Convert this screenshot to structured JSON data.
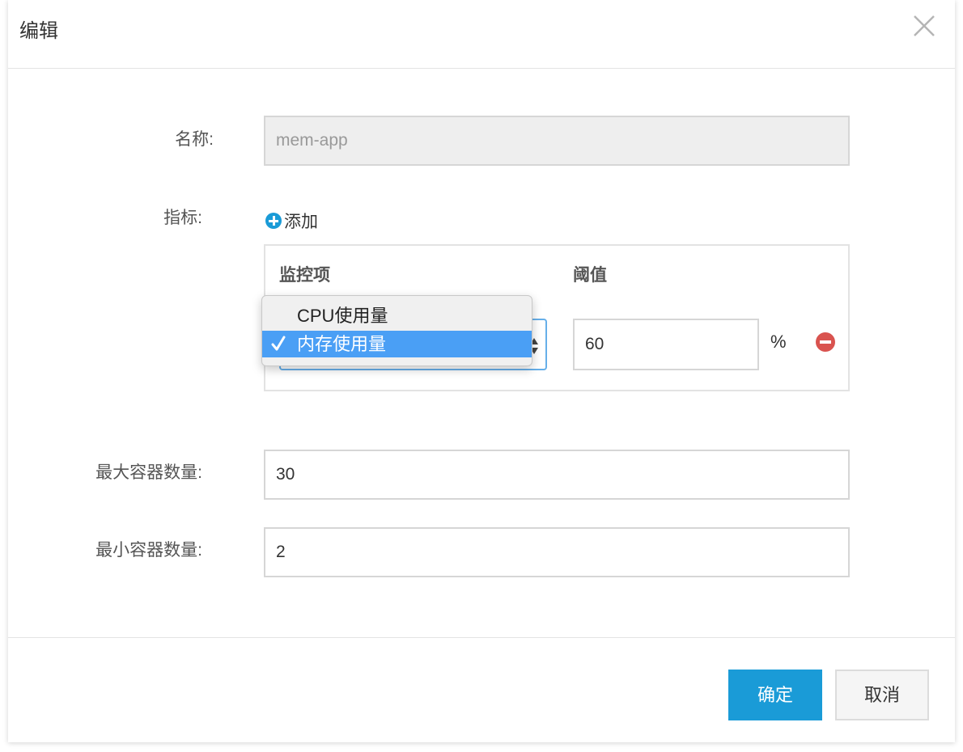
{
  "dialog": {
    "title": "编辑"
  },
  "form": {
    "name_label": "名称:",
    "name_value": "mem-app",
    "metrics_label": "指标:",
    "add_label": "添加",
    "metrics_table": {
      "monitor_header": "监控项",
      "threshold_header": "阈值",
      "rows": [
        {
          "threshold": "60",
          "unit": "%"
        }
      ]
    },
    "monitor_options": [
      {
        "label": "CPU使用量",
        "selected": false
      },
      {
        "label": "内存使用量",
        "selected": true
      }
    ],
    "max_label": "最大容器数量:",
    "max_value": "30",
    "min_label": "最小容器数量:",
    "min_value": "2"
  },
  "footer": {
    "confirm_label": "确定",
    "cancel_label": "取消"
  },
  "icons": {
    "close": "close-icon",
    "add": "plus-circle-icon",
    "remove": "minus-circle-icon",
    "check": "checkmark-icon",
    "select_arrows": "updown-arrows-icon"
  },
  "colors": {
    "primary": "#1a9bd7",
    "danger": "#d9534f",
    "selected_option": "#4a9ff5",
    "focus_border": "#66afe9"
  }
}
